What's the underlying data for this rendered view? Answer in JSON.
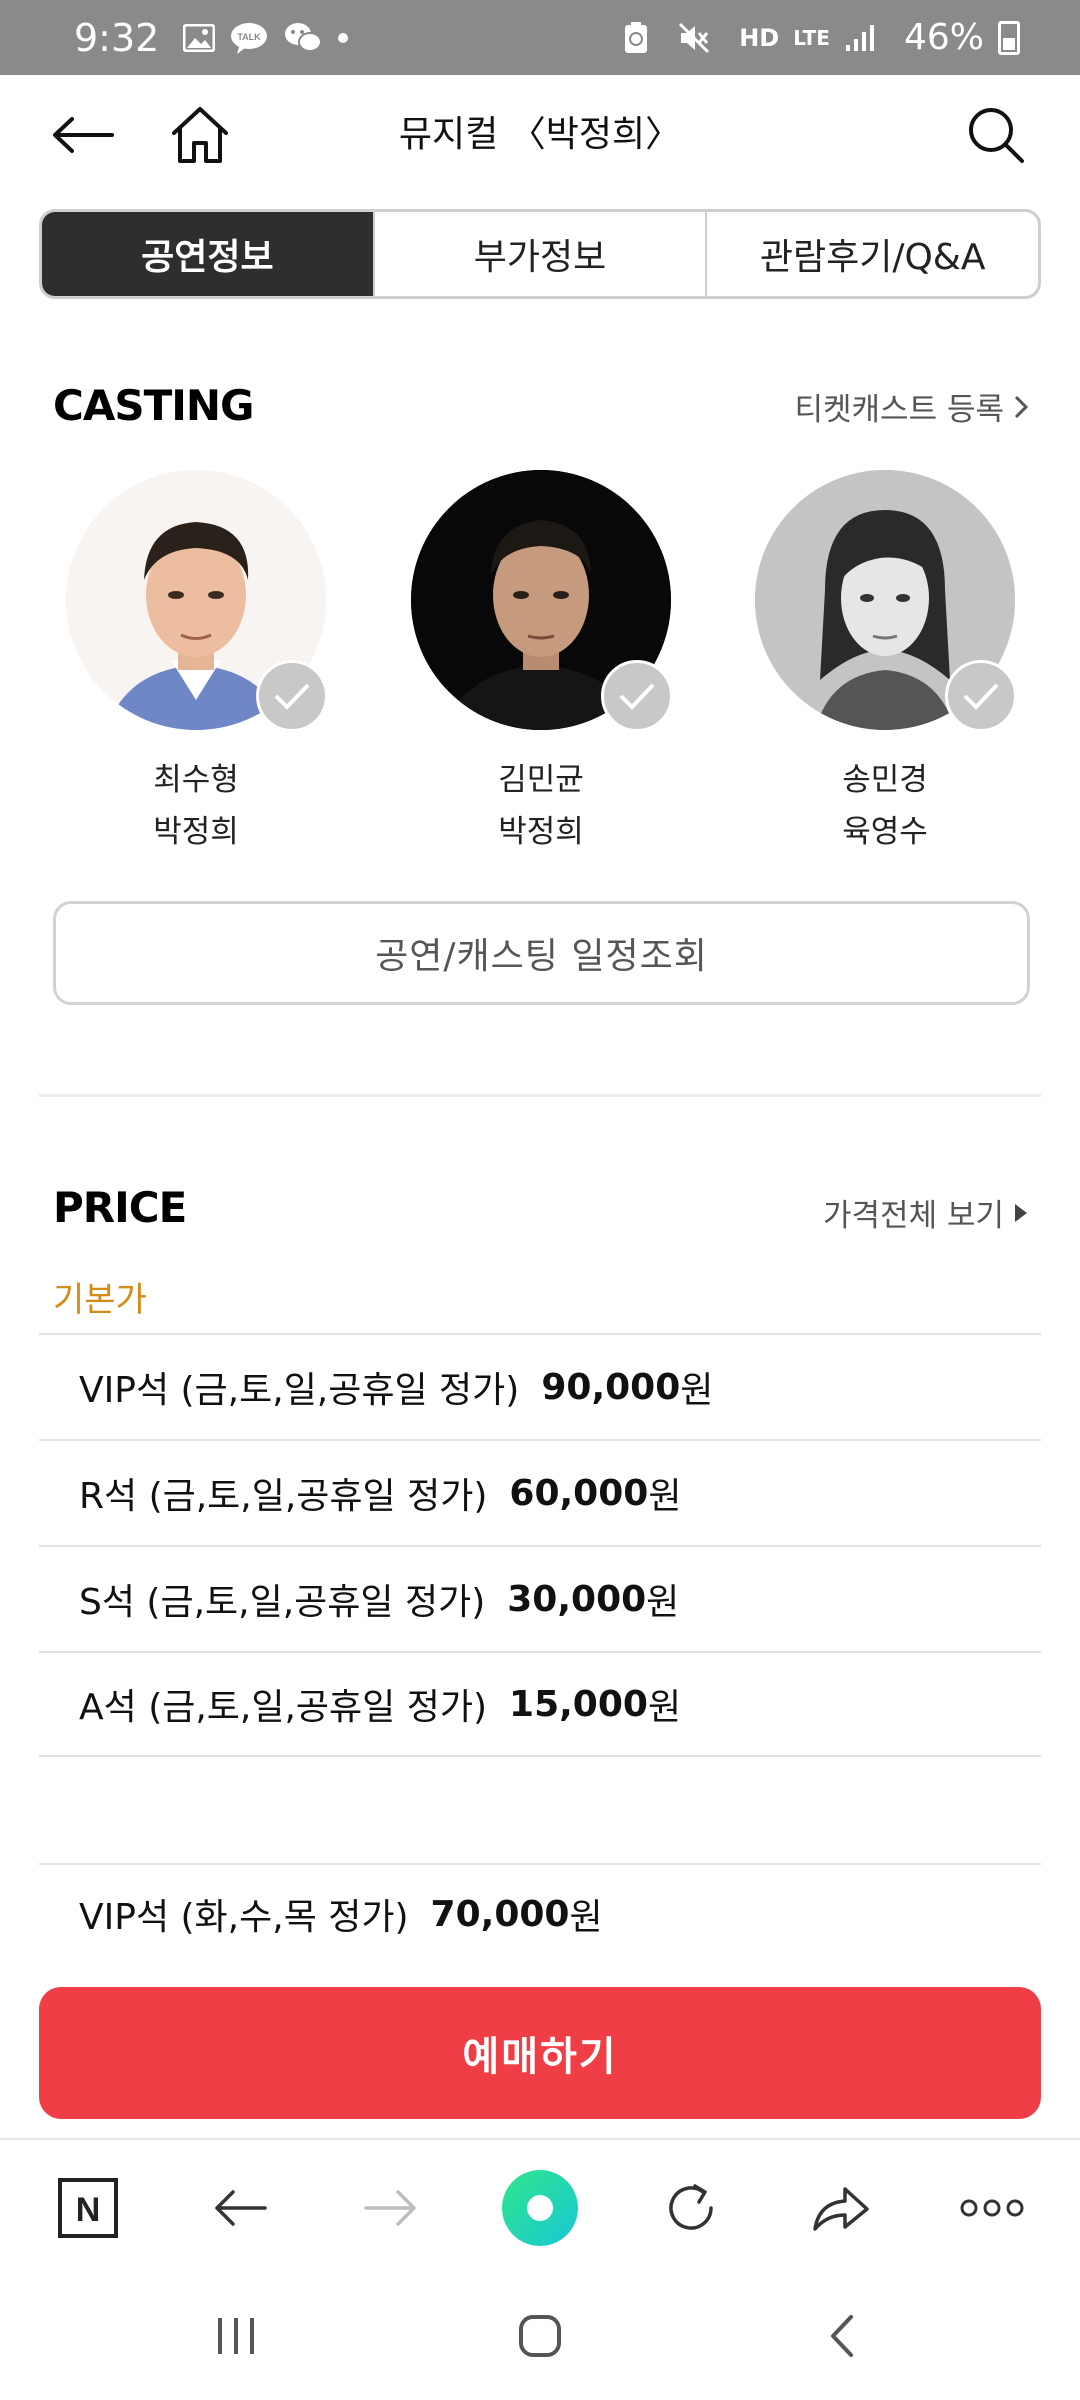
{
  "status_bar": {
    "time": "9:32",
    "network": "HD",
    "network_sub": "LTE",
    "battery": "46%",
    "icons": [
      "gallery-icon",
      "kakaotalk-icon",
      "wechat-icon",
      "dot-icon",
      "battery-saver-icon",
      "mute-icon",
      "signal-icon",
      "battery-icon"
    ],
    "talk_badge": "TALK"
  },
  "header": {
    "title": "뮤지컬 〈박정희〉",
    "icons": [
      "back-arrow-icon",
      "home-icon",
      "search-icon"
    ]
  },
  "tabs": [
    {
      "label": "공연정보",
      "active": true
    },
    {
      "label": "부가정보",
      "active": false
    },
    {
      "label": "관람후기/Q&A",
      "active": false
    }
  ],
  "casting": {
    "title": "CASTING",
    "link": "티켓캐스트 등록",
    "cast": [
      {
        "name": "최수형",
        "role": "박정희"
      },
      {
        "name": "김민균",
        "role": "박정희"
      },
      {
        "name": "송민경",
        "role": "육영수"
      }
    ],
    "schedule_button": "공연/캐스팅 일정조회"
  },
  "price": {
    "title": "PRICE",
    "link": "가격전체 보기",
    "subtitle": "기본가",
    "rows": [
      {
        "label": "VIP석 (금,토,일,공휴일 정가)",
        "amount": "90,000",
        "unit": "원"
      },
      {
        "label": "R석 (금,토,일,공휴일 정가)",
        "amount": "60,000",
        "unit": "원"
      },
      {
        "label": "S석 (금,토,일,공휴일 정가)",
        "amount": "30,000",
        "unit": "원"
      },
      {
        "label": "A석 (금,토,일,공휴일 정가)",
        "amount": "15,000",
        "unit": "원"
      },
      {
        "label": "VIP석 (화,수,목 정가)",
        "amount": "70,000",
        "unit": "원"
      }
    ]
  },
  "book_button": "예매하기",
  "browser_bar": {
    "naver_letter": "N",
    "icons": [
      "naver-home-icon",
      "browser-back-icon",
      "browser-forward-icon",
      "green-dot-icon",
      "refresh-icon",
      "share-icon",
      "more-icon"
    ]
  },
  "system_nav": {
    "icons": [
      "recent-apps-icon",
      "home-button-icon",
      "back-button-icon"
    ]
  },
  "colors": {
    "accent_red": "#ef3e46",
    "subtitle_orange": "#d68a1a",
    "tab_active": "#2e2e2e",
    "status_bar": "#8a8a8a"
  }
}
